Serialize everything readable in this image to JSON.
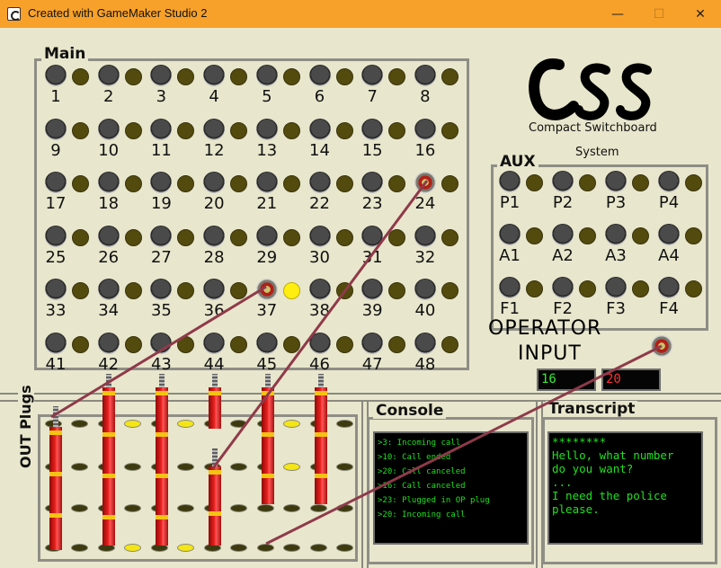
{
  "window": {
    "title": "Created with GameMaker Studio 2",
    "minimize_glyph": "—",
    "maximize_glyph": "☐",
    "close_glyph": "✕"
  },
  "logo": {
    "text": "CSS",
    "subtitle": "Compact Switchboard"
  },
  "main_panel": {
    "title": "Main",
    "jacks": [
      "1",
      "2",
      "3",
      "4",
      "5",
      "6",
      "7",
      "8",
      "9",
      "10",
      "11",
      "12",
      "13",
      "14",
      "15",
      "16",
      "17",
      "18",
      "19",
      "20",
      "21",
      "22",
      "23",
      "24",
      "25",
      "26",
      "27",
      "28",
      "29",
      "30",
      "31",
      "32",
      "33",
      "34",
      "35",
      "36",
      "37",
      "38",
      "39",
      "40",
      "41",
      "42",
      "43",
      "44",
      "45",
      "46",
      "47",
      "48"
    ],
    "active_jacks": [
      "24",
      "37"
    ],
    "lit_lamps": [
      "37"
    ]
  },
  "aux_panel": {
    "system_label": "System",
    "title": "AUX",
    "jacks": [
      "P1",
      "P2",
      "P3",
      "P4",
      "A1",
      "A2",
      "A3",
      "A4",
      "F1",
      "F2",
      "F3",
      "F4"
    ]
  },
  "operator": {
    "line1": "OPERATOR",
    "line2": "INPUT",
    "display_left": "16",
    "display_right": "20"
  },
  "out_plugs": {
    "title": "OUT Plugs"
  },
  "console": {
    "title": "Console",
    "lines": [
      ">3: Incoming call",
      ">10: Call ended",
      ">20: Call canceled",
      ">16: Call canceled",
      ">23: Plugged in OP plug",
      ">20: Incoming call"
    ]
  },
  "transcript": {
    "title": "Transcript",
    "lines": [
      "********",
      "Hello, what number",
      "do you want?",
      "...",
      "I need the police",
      "please."
    ]
  },
  "colors": {
    "background": "#e8e6cc",
    "titlebar": "#f7a12a",
    "cable": "#8e3a4a",
    "lamp_lit": "#ffee10",
    "screen_text": "#1fe21f",
    "display_right_text": "#ff3030"
  }
}
